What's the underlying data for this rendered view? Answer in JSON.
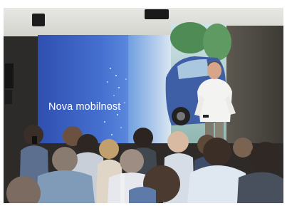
{
  "slide": {
    "headline": "Nova mobilnost"
  },
  "colors": {
    "screen_blue": "#3f63c4",
    "car_blue": "#3e5fa6",
    "ceiling": "#d9dbd5",
    "audience_dark": "#2d2a27"
  },
  "icons": [
    "speaker",
    "ceiling-light",
    "smartphone"
  ]
}
